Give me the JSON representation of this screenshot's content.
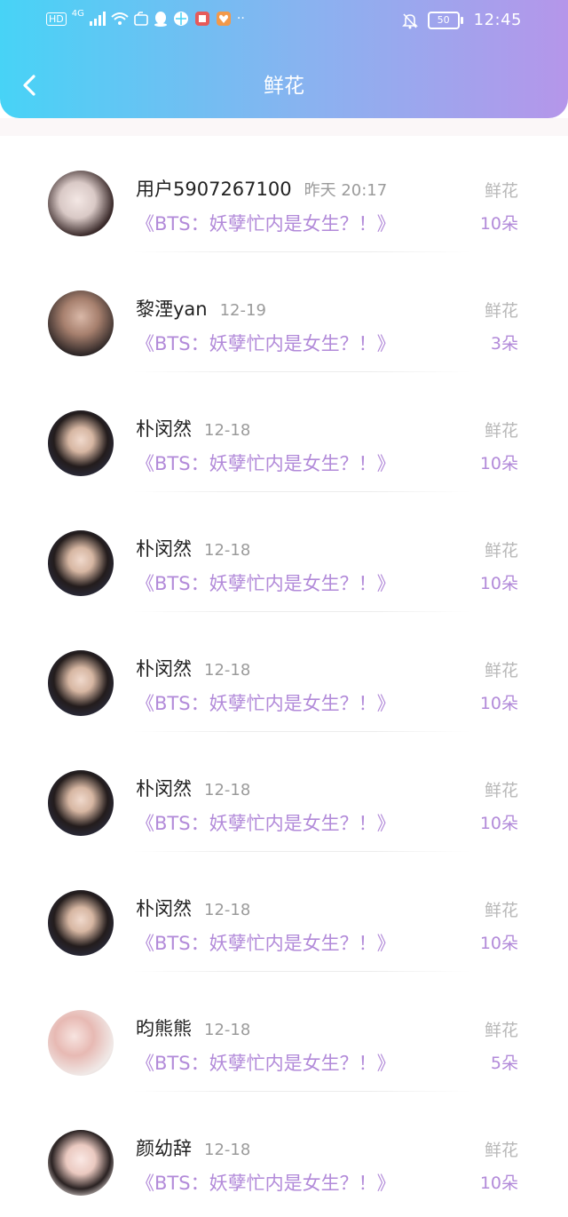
{
  "status_bar": {
    "left_labels": [
      "HD",
      "4G"
    ],
    "battery": "50",
    "time": "12:45"
  },
  "header": {
    "title": "鲜花",
    "back_icon": "chevron-left-icon"
  },
  "items": [
    {
      "name": "用户5907267100",
      "time": "昨天 20:17",
      "book": "《BTS：妖孽忙内是女生？！》",
      "gift_label": "鲜花",
      "gift_count": "10朵"
    },
    {
      "name": "黎湮yan",
      "time": "12-19",
      "book": "《BTS：妖孽忙内是女生？！》",
      "gift_label": "鲜花",
      "gift_count": "3朵"
    },
    {
      "name": "朴闵然",
      "time": "12-18",
      "book": "《BTS：妖孽忙内是女生？！》",
      "gift_label": "鲜花",
      "gift_count": "10朵"
    },
    {
      "name": "朴闵然",
      "time": "12-18",
      "book": "《BTS：妖孽忙内是女生？！》",
      "gift_label": "鲜花",
      "gift_count": "10朵"
    },
    {
      "name": "朴闵然",
      "time": "12-18",
      "book": "《BTS：妖孽忙内是女生？！》",
      "gift_label": "鲜花",
      "gift_count": "10朵"
    },
    {
      "name": "朴闵然",
      "time": "12-18",
      "book": "《BTS：妖孽忙内是女生？！》",
      "gift_label": "鲜花",
      "gift_count": "10朵"
    },
    {
      "name": "朴闵然",
      "time": "12-18",
      "book": "《BTS：妖孽忙内是女生？！》",
      "gift_label": "鲜花",
      "gift_count": "10朵"
    },
    {
      "name": "昀熊熊",
      "time": "12-18",
      "book": "《BTS：妖孽忙内是女生？！》",
      "gift_label": "鲜花",
      "gift_count": "5朵"
    },
    {
      "name": "颜幼辞",
      "time": "12-18",
      "book": "《BTS：妖孽忙内是女生？！》",
      "gift_label": "鲜花",
      "gift_count": "10朵"
    }
  ],
  "colors": {
    "gradient_start": "#47d3f6",
    "gradient_end": "#b596ea",
    "accent_purple": "#b28ad9",
    "gray_text": "#9b9b9b"
  }
}
